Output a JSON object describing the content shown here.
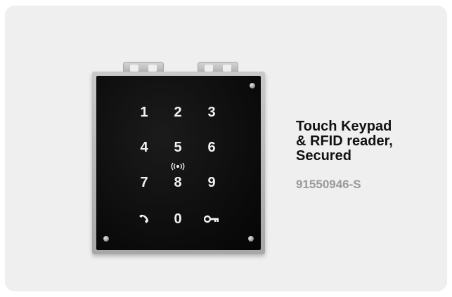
{
  "product": {
    "title_lines": [
      "Touch Keypad",
      "& RFID reader,",
      "Secured"
    ],
    "sku": "91550946-S"
  },
  "keypad": {
    "keys": [
      "1",
      "2",
      "3",
      "4",
      "5",
      "6",
      "7",
      "8",
      "9",
      "0"
    ],
    "call_key_icon": "phone-handset-icon",
    "key_key_icon": "key-icon",
    "rfid_icon": "rfid-wave-icon"
  },
  "colors": {
    "card_background": "#efefef",
    "panel": "#0b0b0b",
    "key_glyph": "#f2f2f2",
    "title": "#111111",
    "sku": "#9a9a9a"
  }
}
